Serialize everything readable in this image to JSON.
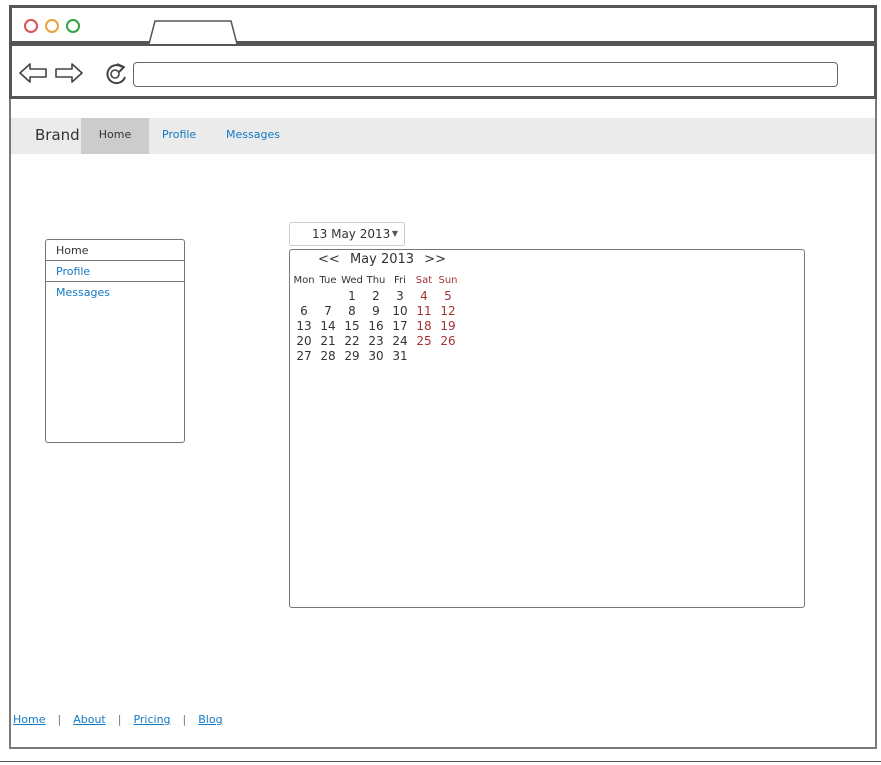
{
  "browser": {
    "url_value": "",
    "colors": {
      "close": "#d9534f",
      "minimize": "#e8a33d",
      "maximize": "#35a144"
    },
    "icons": [
      "back-arrow-icon",
      "forward-arrow-icon",
      "reload-icon"
    ]
  },
  "navbar": {
    "brand": "Brand",
    "items": [
      {
        "label": "Home",
        "active": true
      },
      {
        "label": "Profile",
        "active": false
      },
      {
        "label": "Messages",
        "active": false
      }
    ]
  },
  "sidebar": {
    "items": [
      {
        "label": "Home"
      },
      {
        "label": "Profile"
      },
      {
        "label": "Messages"
      }
    ]
  },
  "date_picker": {
    "value": "13 May 2013",
    "caret": "▼"
  },
  "calendar": {
    "prev": "<<",
    "month_label": "May 2013",
    "next": ">>",
    "weekdays": [
      "Mon",
      "Tue",
      "Wed",
      "Thu",
      "Fri",
      "Sat",
      "Sun"
    ],
    "weekend_color": "#a23434",
    "weeks": [
      [
        "",
        "",
        "1",
        "2",
        "3",
        "4",
        "5"
      ],
      [
        "6",
        "7",
        "8",
        "9",
        "10",
        "11",
        "12"
      ],
      [
        "13",
        "14",
        "15",
        "16",
        "17",
        "18",
        "19"
      ],
      [
        "20",
        "21",
        "22",
        "23",
        "24",
        "25",
        "26"
      ],
      [
        "27",
        "28",
        "29",
        "30",
        "31",
        "",
        ""
      ]
    ]
  },
  "footer": {
    "links": [
      "Home",
      "About",
      "Pricing",
      "Blog"
    ],
    "separator": "|"
  }
}
